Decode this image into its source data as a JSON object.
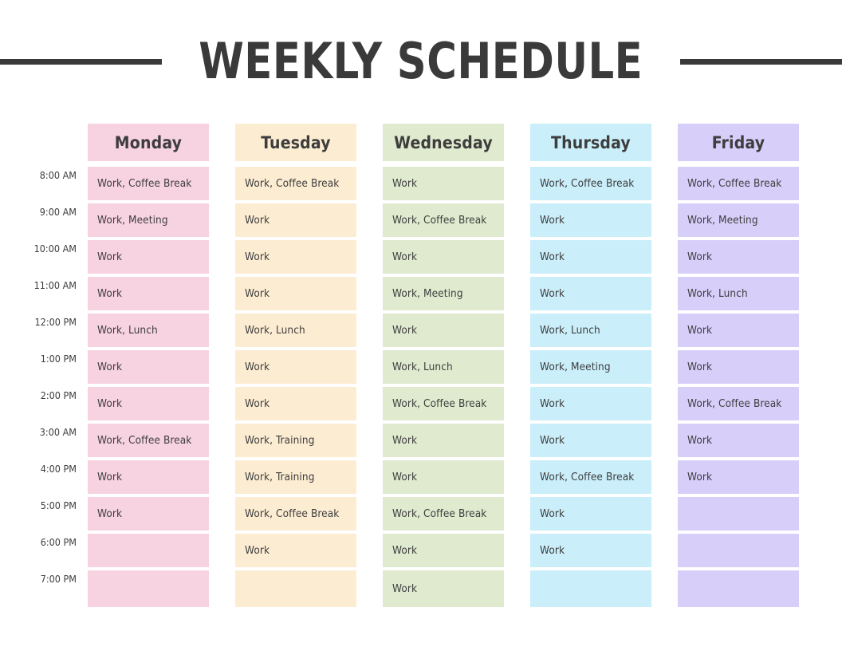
{
  "title": "WEEKLY SCHEDULE",
  "times": [
    "8:00 AM",
    "9:00 AM",
    "10:00 AM",
    "11:00 AM",
    "12:00 PM",
    "1:00 PM",
    "2:00 PM",
    "3:00 AM",
    "4:00 PM",
    "5:00 PM",
    "6:00 PM",
    "7:00 PM"
  ],
  "colors": {
    "monday": "#f7d2e1",
    "tuesday": "#fcecd2",
    "wednesday": "#dfeacf",
    "thursday": "#caeefa",
    "friday": "#d8cefa",
    "title": "#3a3a3a",
    "text": "#3d3d3d",
    "background": "#ffffff"
  },
  "columns": [
    {
      "day": "Monday",
      "color": "#f7d2e1",
      "cells": [
        "Work, Coffee Break",
        "Work, Meeting",
        "Work",
        "Work",
        "Work, Lunch",
        "Work",
        "Work",
        "Work, Coffee Break",
        "Work",
        "Work",
        "",
        ""
      ]
    },
    {
      "day": "Tuesday",
      "color": "#fcecd2",
      "cells": [
        "Work, Coffee Break",
        "Work",
        "Work",
        "Work",
        "Work, Lunch",
        "Work",
        "Work",
        "Work, Training",
        "Work, Training",
        "Work, Coffee Break",
        "Work",
        ""
      ]
    },
    {
      "day": "Wednesday",
      "color": "#dfeacf",
      "cells": [
        "Work",
        "Work, Coffee Break",
        "Work",
        "Work, Meeting",
        "Work",
        "Work, Lunch",
        "Work, Coffee Break",
        "Work",
        "Work",
        "Work, Coffee Break",
        "Work",
        "Work"
      ]
    },
    {
      "day": "Thursday",
      "color": "#caeefa",
      "cells": [
        "Work, Coffee Break",
        "Work",
        "Work",
        "Work",
        "Work, Lunch",
        "Work, Meeting",
        "Work",
        "Work",
        "Work, Coffee Break",
        "Work",
        "Work",
        ""
      ]
    },
    {
      "day": "Friday",
      "color": "#d8cefa",
      "cells": [
        "Work, Coffee Break",
        "Work, Meeting",
        "Work",
        "Work, Lunch",
        "Work",
        "Work",
        "Work, Coffee Break",
        "Work",
        "Work",
        "",
        "",
        ""
      ]
    }
  ]
}
